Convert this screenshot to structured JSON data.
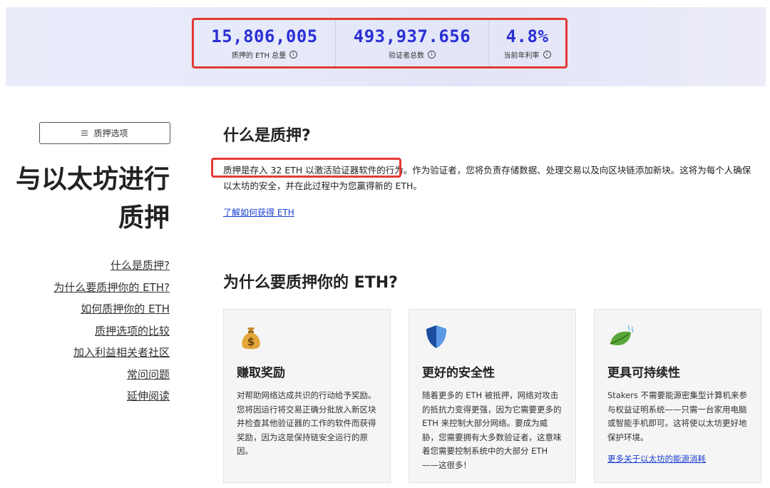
{
  "stats": [
    {
      "value": "15,806,005",
      "label": "质押的 ETH 总量"
    },
    {
      "value": "493,937.656",
      "label": "验证者总数"
    },
    {
      "value": "4.8%",
      "label": "当前年利率"
    }
  ],
  "sidebar": {
    "menu_button": "质押选项",
    "title_line1": "与以太坊进行",
    "title_line2": "质押",
    "toc": [
      "什么是质押?",
      "为什么要质押你的 ETH?",
      "如何质押你的 ETH",
      "质押选项的比较",
      "加入利益相关者社区",
      "常问问题",
      "延伸阅读"
    ]
  },
  "main": {
    "section1_title": "什么是质押?",
    "intro_highlight": "质押是存入 32 ETH 以激活验证器软件的行为",
    "intro_rest": "。作为验证者，您将负责存储数据、处理交易以及向区块链添加新块。这将为每个人确保以太坊的安全，并在此过程中为您赢得新的 ETH。",
    "learn_link": "了解如何获得 ETH",
    "section2_title": "为什么要质押你的 ETH?",
    "cards": [
      {
        "icon": "money-bag-icon",
        "title": "赚取奖励",
        "text": "对帮助网络达成共识的行动给予奖励。您将因运行将交易正确分批放入新区块并检查其他验证器的工作的软件而获得奖励，因为这是保持链安全运行的原因。"
      },
      {
        "icon": "shield-icon",
        "title": "更好的安全性",
        "text": "随着更多的 ETH 被抵押，网络对攻击的抵抗力变得更强，因为它需要更多的 ETH 来控制大部分网络。要成为威胁，您需要拥有大多数验证者，这意味着您需要控制系统中的大部分 ETH——这很多！"
      },
      {
        "icon": "leaf-icon",
        "title": "更具可持续性",
        "text": "Stakers 不需要能源密集型计算机来参与权益证明系统——只需一台家用电脑或智能手机即可。这将使以太坊更好地保护环境。",
        "link": "更多关于以太坊的能源消耗"
      }
    ]
  },
  "colors": {
    "accent": "#2b2fd6",
    "highlight_border": "#e53935",
    "link": "#1a3fd1",
    "banner_bg": "#e6eaf9"
  }
}
